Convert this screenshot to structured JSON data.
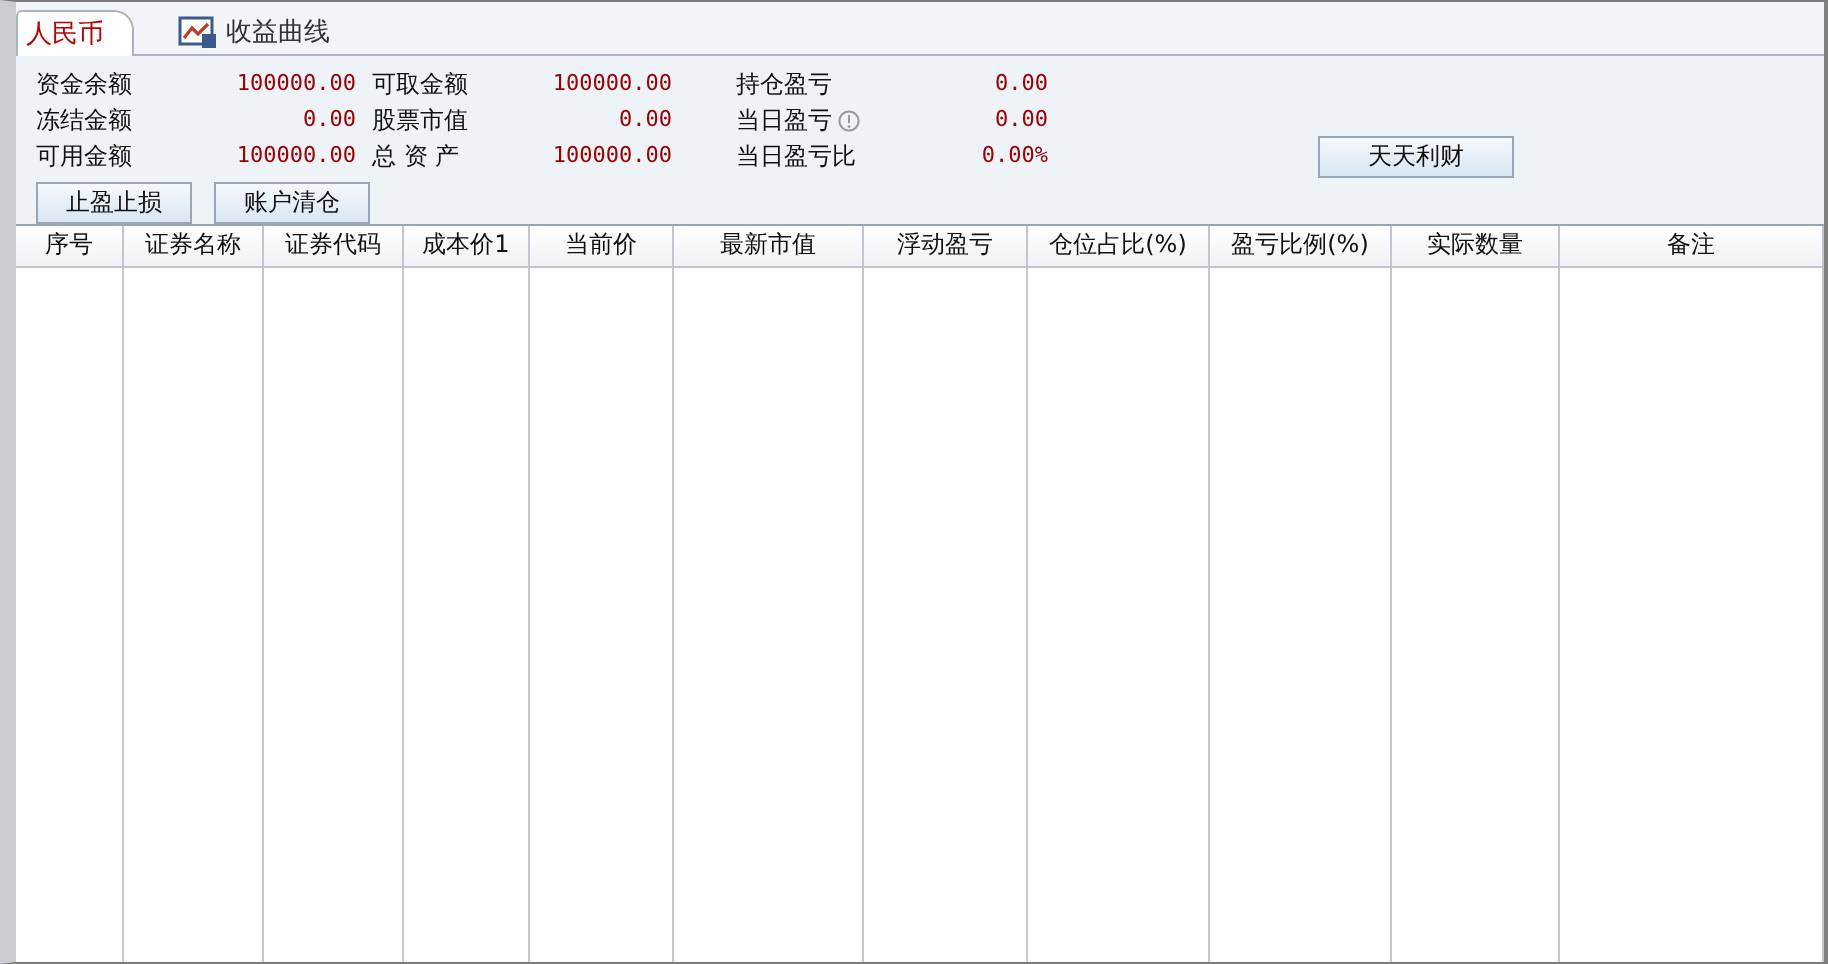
{
  "tabs": [
    {
      "label": "人民币",
      "selected": true,
      "icon": false
    },
    {
      "label": "收益曲线",
      "selected": false,
      "icon": true
    }
  ],
  "summary": [
    {
      "label": "资金余额",
      "value": "100000.00",
      "info": false
    },
    {
      "label": "可取金额",
      "value": "100000.00",
      "info": false
    },
    {
      "label": "持仓盈亏",
      "value": "0.00",
      "info": false
    },
    {
      "label": "冻结金额",
      "value": "0.00",
      "info": false
    },
    {
      "label": "股票市值",
      "value": "0.00",
      "info": false
    },
    {
      "label": "当日盈亏",
      "value": "0.00",
      "info": true
    },
    {
      "label": "可用金额",
      "value": "100000.00",
      "info": false
    },
    {
      "label": "总 资 产",
      "value": "100000.00",
      "info": false
    },
    {
      "label": "当日盈亏比",
      "value": "0.00%",
      "info": false
    }
  ],
  "buttons": [
    "止盈止损",
    "账户清仓"
  ],
  "side_button": "天天利财",
  "columns": [
    "序号",
    "证券名称",
    "证券代码",
    "成本价1",
    "当前价",
    "最新市值",
    "浮动盈亏",
    "仓位占比(%)",
    "盈亏比例(%)",
    "实际数量",
    "备注"
  ]
}
